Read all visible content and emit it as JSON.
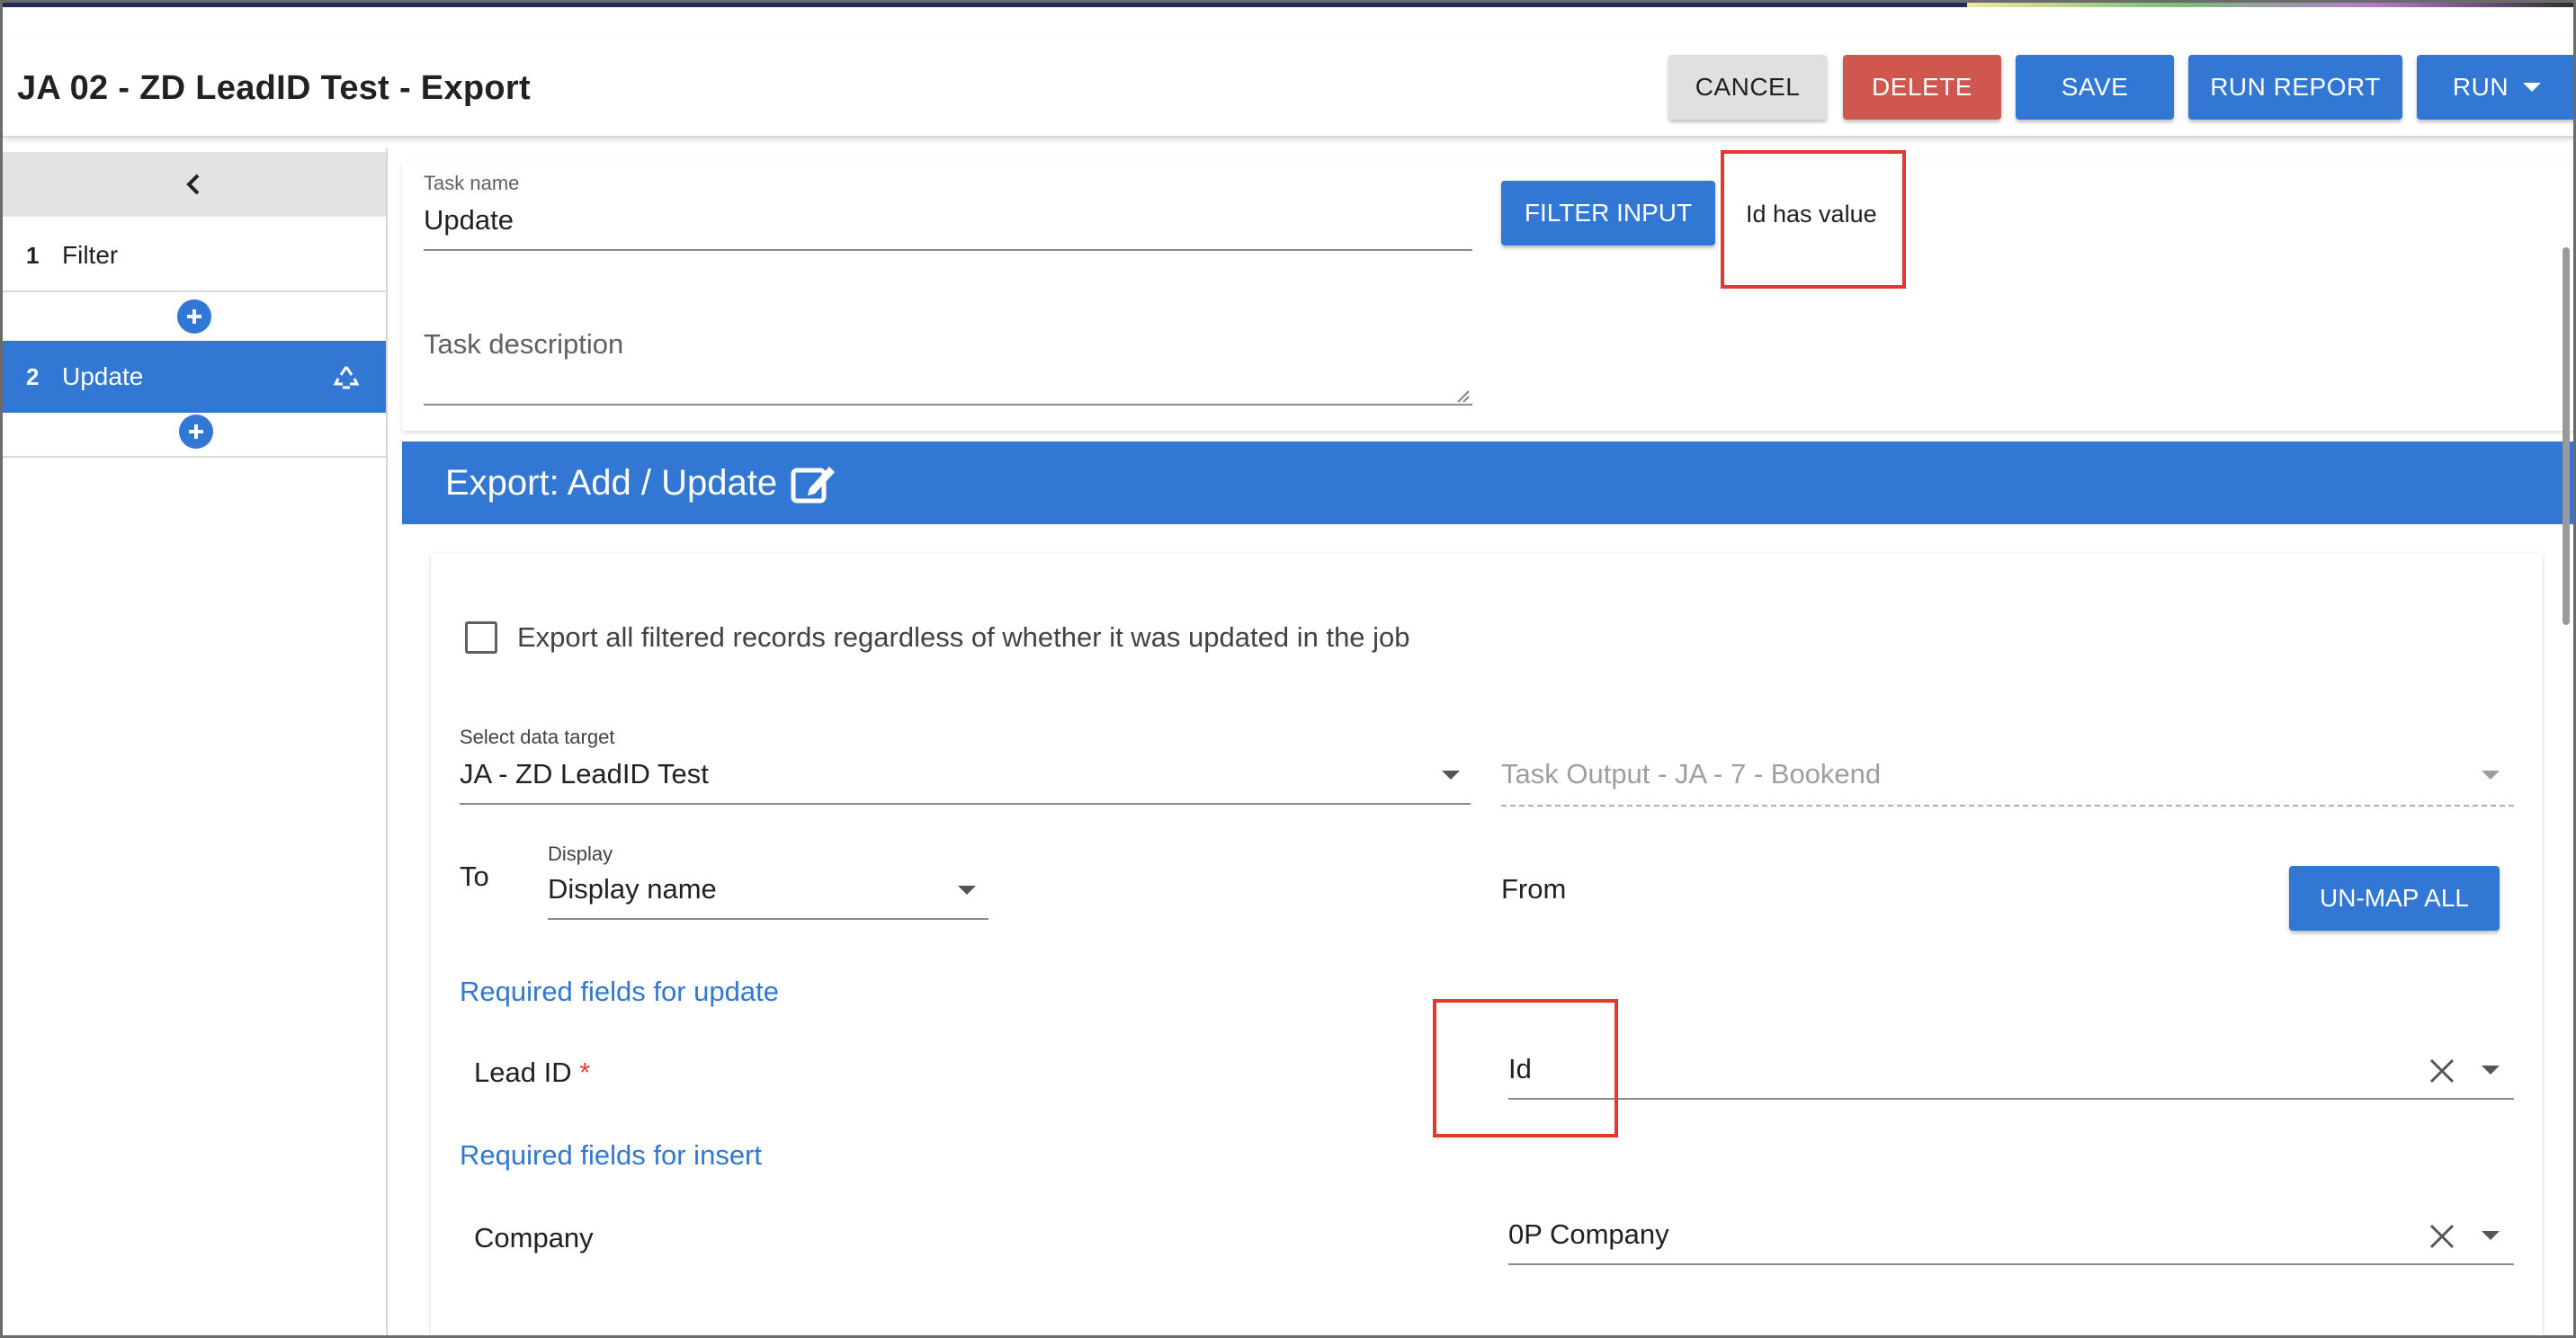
{
  "header": {
    "title": "JA 02 - ZD LeadID Test - Export",
    "cancel_label": "CANCEL",
    "delete_label": "DELETE",
    "save_label": "SAVE",
    "run_report_label": "RUN REPORT",
    "run_label": "RUN"
  },
  "sidebar": {
    "steps": [
      {
        "number": "1",
        "label": "Filter"
      },
      {
        "number": "2",
        "label": "Update"
      }
    ]
  },
  "task": {
    "name_label": "Task name",
    "name_value": "Update",
    "description_placeholder": "Task description",
    "filter_button_label": "FILTER INPUT",
    "filter_summary": "Id has value"
  },
  "export": {
    "section_title": "Export: Add / Update",
    "checkbox_label": "Export all filtered records regardless of whether it was updated in the job",
    "target_label": "Select data target",
    "target_value": "JA - ZD LeadID Test",
    "source_value": "Task Output - JA - 7 - Bookend",
    "to_label": "To",
    "display_label": "Display",
    "display_value": "Display name",
    "from_label": "From",
    "unmap_label": "UN-MAP ALL",
    "required_update_label": "Required fields for update",
    "required_insert_label": "Required fields for insert",
    "fields": [
      {
        "to": "Lead ID",
        "required_marker": "*",
        "from": "Id"
      },
      {
        "to": "Company",
        "from": "0P Company"
      }
    ]
  },
  "colors": {
    "primary": "#3277d3",
    "danger": "#d0574f",
    "highlight_box": "#e2392d"
  }
}
